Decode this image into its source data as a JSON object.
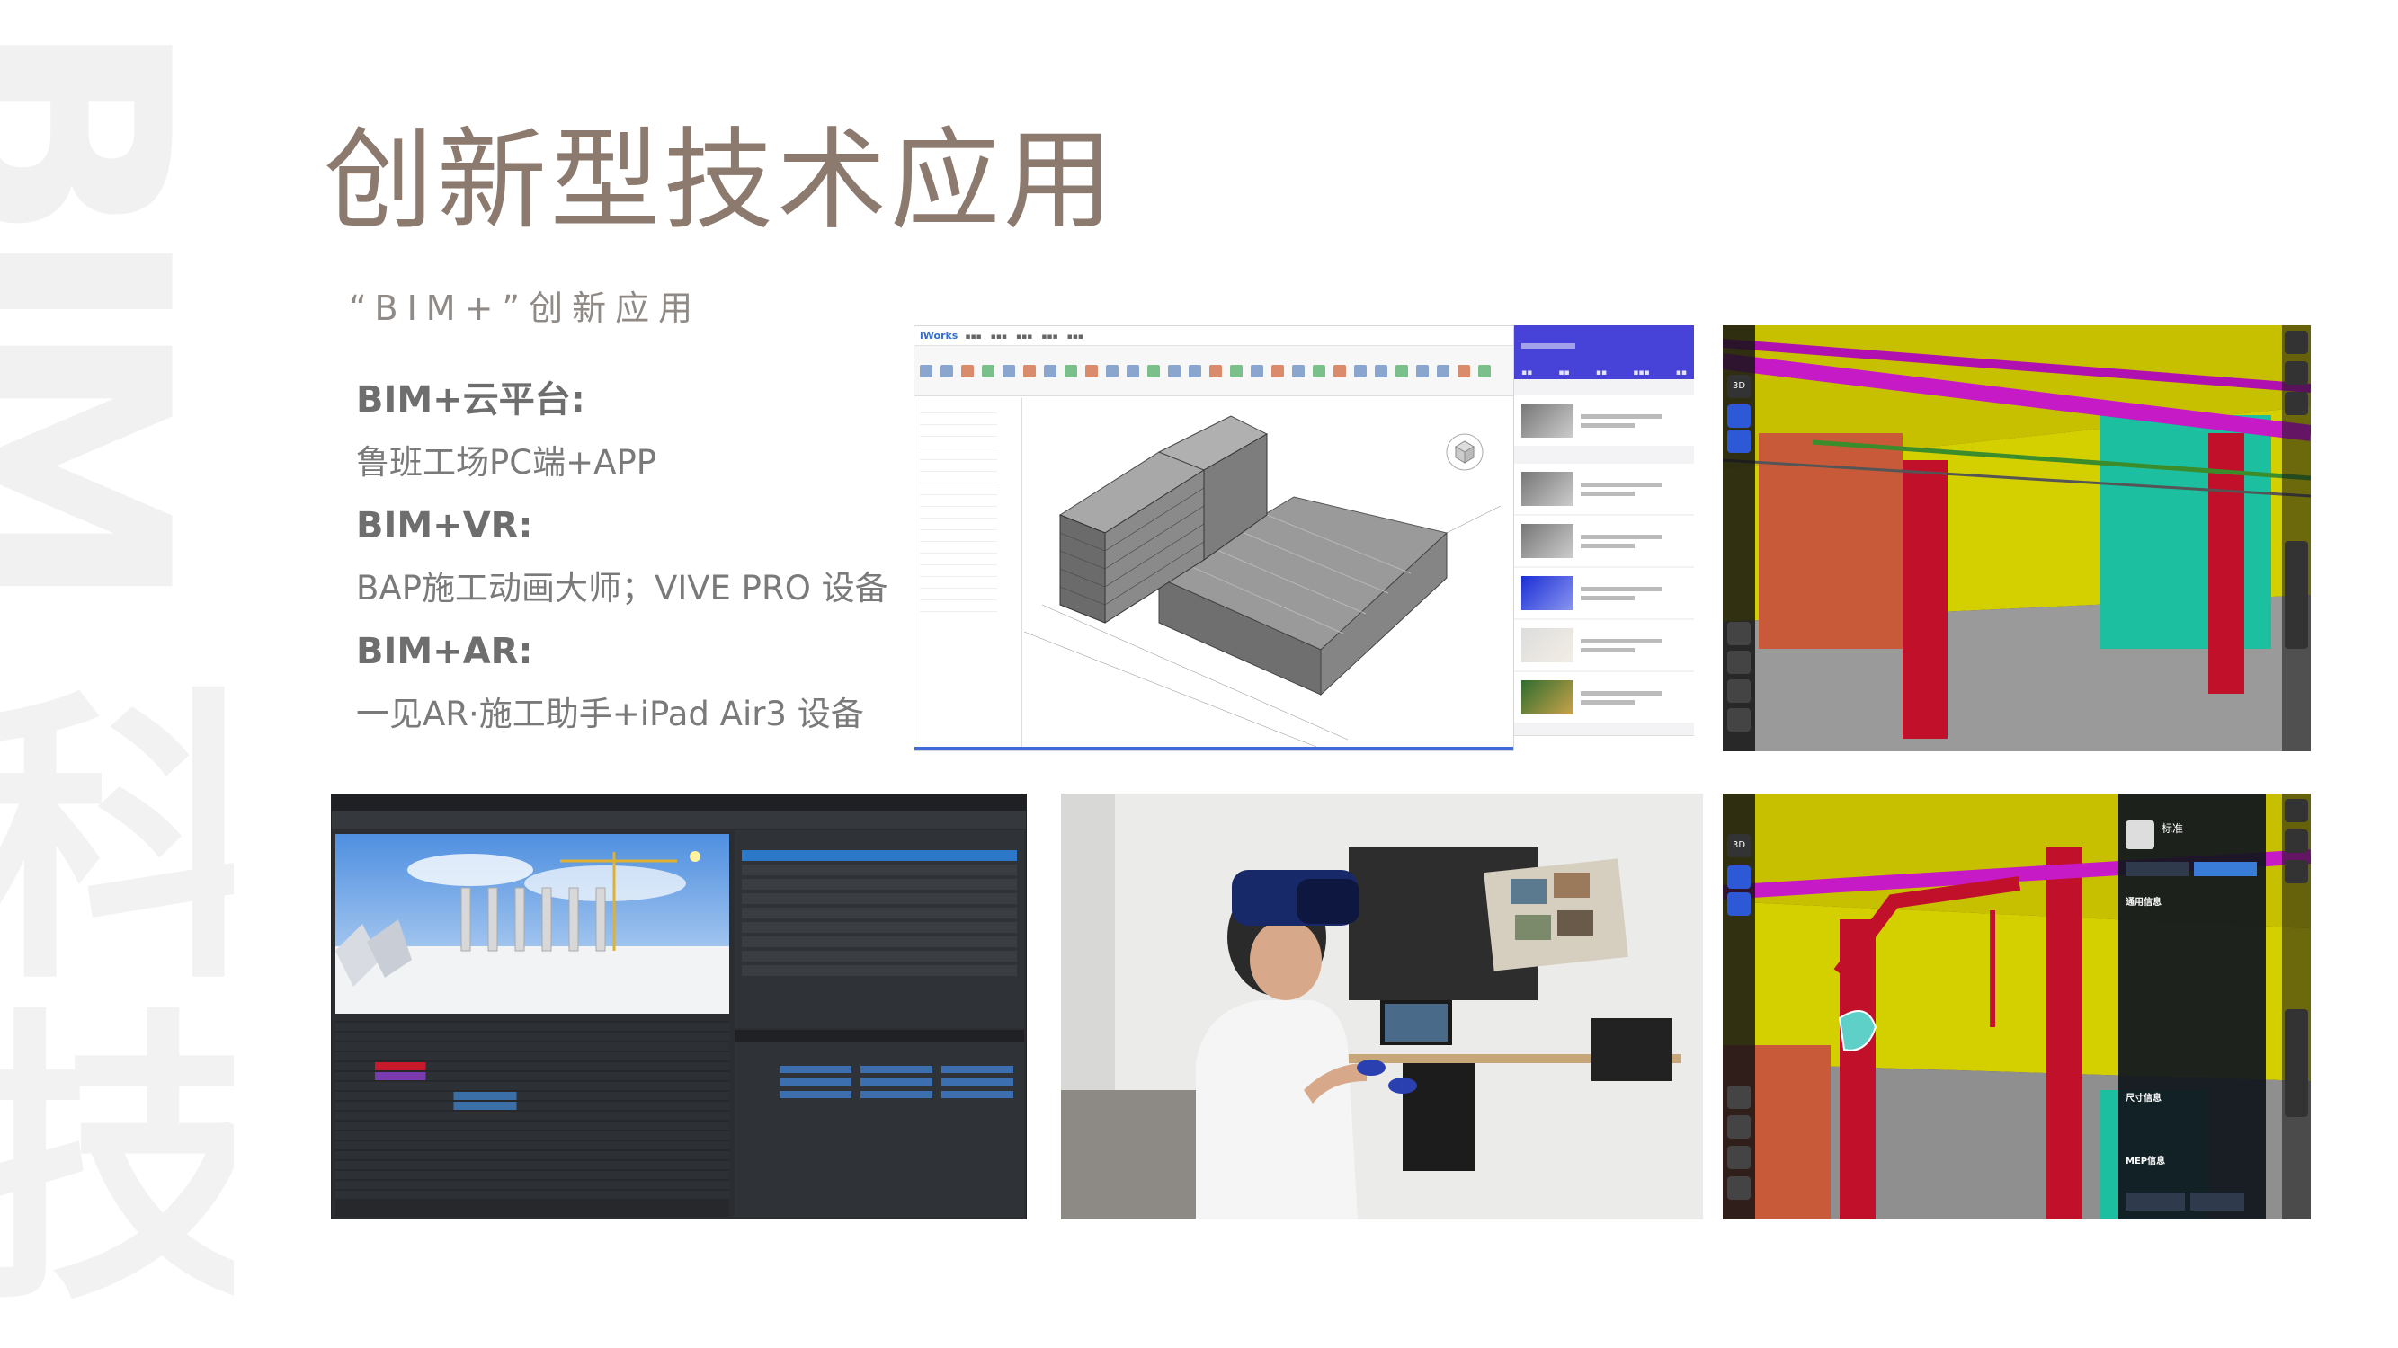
{
  "watermark": {
    "text": "BIM",
    "glyph": "科技"
  },
  "title": "创新型技术应用",
  "subtitle": "“BIM+”创新应用",
  "features": [
    {
      "heading": "BIM+云平台:",
      "description": "鲁班工场PC端+APP"
    },
    {
      "heading": "BIM+VR:",
      "description": "BAP施工动画大师；VIVE PRO 设备"
    },
    {
      "heading": "BIM+AR:",
      "description": "一见AR·施工助手+iPad Air3 设备"
    }
  ],
  "pc_app": {
    "logo": "iWorks"
  },
  "ar_app": {
    "mode_3d": "3D"
  },
  "ar_panel": {
    "title": "标准",
    "section_general": "通用信息",
    "section_size": "尺寸信息",
    "section_mep": "MEP信息"
  }
}
